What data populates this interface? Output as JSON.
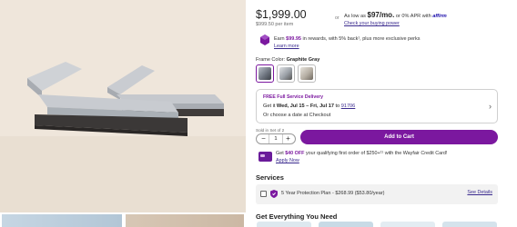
{
  "price": {
    "amount": "$1,999.00",
    "per_item": "$999.50 per item",
    "or": "or",
    "afford_prefix": "As low as ",
    "afford_amount": "$97/mo.",
    "afford_suffix": " or 0% APR with ",
    "afford_brand": "affirm",
    "buying_power_link": "Check your buying power"
  },
  "rewards": {
    "prefix": "Earn ",
    "amount": "$99.95",
    "suffix": " in rewards, with 5% back¹, plus more exclusive perks",
    "learn_link": "Learn more"
  },
  "frame": {
    "label_prefix": "Frame Color: ",
    "selected": "Graphite Gray"
  },
  "delivery": {
    "free_label": "FREE Full Service Delivery",
    "date_prefix": "Get it ",
    "date_range": "Wed, Jul 15 – Fri, Jul 17",
    "date_middle": " to ",
    "zip": "91706",
    "alternate": "Or choose a date at Checkout"
  },
  "quantity": {
    "sold_label": "Sold in Set of 2",
    "minus": "−",
    "value": "1",
    "plus": "+"
  },
  "cart": {
    "button_label": "Add to Cart"
  },
  "credit": {
    "prefix": "Get ",
    "amount": "$40 OFF",
    "suffix": " your qualifying first order of $250+¹¹ with the Wayfair Credit Card!",
    "apply_link": "Apply Now"
  },
  "services": {
    "title": "Services",
    "plan_text": "5 Year Protection Plan - $268.99 ($53.80/year)",
    "details_link": "See Details"
  },
  "everything": {
    "title": "Get Everything You Need"
  },
  "colors": {
    "brand_purple": "#7b189f",
    "link": "#3a2a8e"
  }
}
